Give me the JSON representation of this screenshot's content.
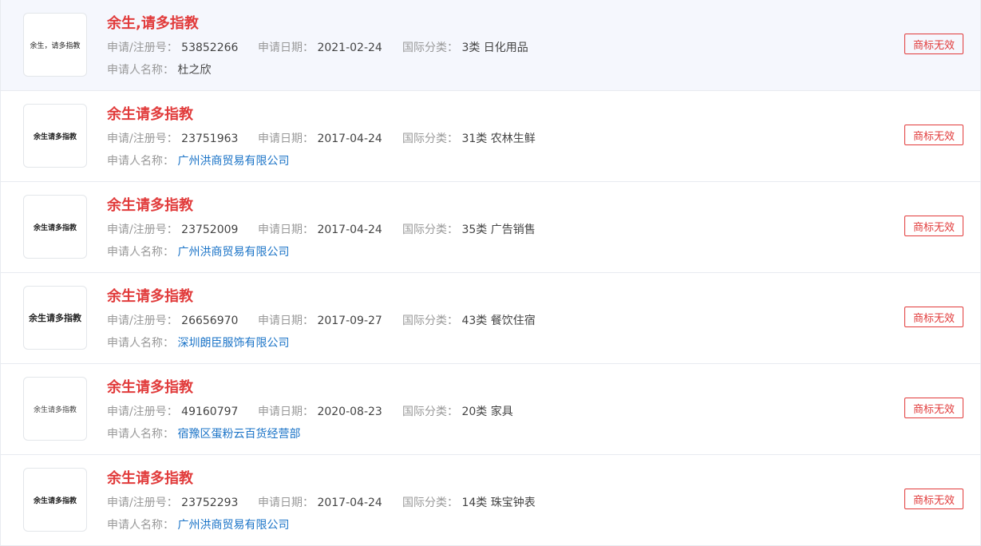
{
  "labels": {
    "reg_no": "申请/注册号：",
    "apply_date": "申请日期：",
    "intl_class": "国际分类：",
    "applicant": "申请人名称："
  },
  "items": [
    {
      "logo_text": "余生，请多指教",
      "name": "余生,请多指教",
      "reg_no": "53852266",
      "apply_date": "2021-02-24",
      "intl_class": "3类 日化用品",
      "applicant": "杜之欣",
      "status": "商标无效"
    },
    {
      "logo_text": "余生请多指教",
      "name": "余生请多指教",
      "reg_no": "23751963",
      "apply_date": "2017-04-24",
      "intl_class": "31类 农林生鲜",
      "applicant": "广州洪商贸易有限公司",
      "status": "商标无效"
    },
    {
      "logo_text": "余生请多指教",
      "name": "余生请多指教",
      "reg_no": "23752009",
      "apply_date": "2017-04-24",
      "intl_class": "35类 广告销售",
      "applicant": "广州洪商贸易有限公司",
      "status": "商标无效"
    },
    {
      "logo_text": "余生请多指教",
      "name": "余生请多指教",
      "reg_no": "26656970",
      "apply_date": "2017-09-27",
      "intl_class": "43类 餐饮住宿",
      "applicant": "深圳朗臣服饰有限公司",
      "status": "商标无效"
    },
    {
      "logo_text": "余生请多指教",
      "name": "余生请多指教",
      "reg_no": "49160797",
      "apply_date": "2020-08-23",
      "intl_class": "20类 家具",
      "applicant": "宿豫区蛋粉云百货经营部",
      "status": "商标无效"
    },
    {
      "logo_text": "余生请多指教",
      "name": "余生请多指教",
      "reg_no": "23752293",
      "apply_date": "2017-04-24",
      "intl_class": "14类 珠宝钟表",
      "applicant": "广州洪商贸易有限公司",
      "status": "商标无效"
    }
  ]
}
